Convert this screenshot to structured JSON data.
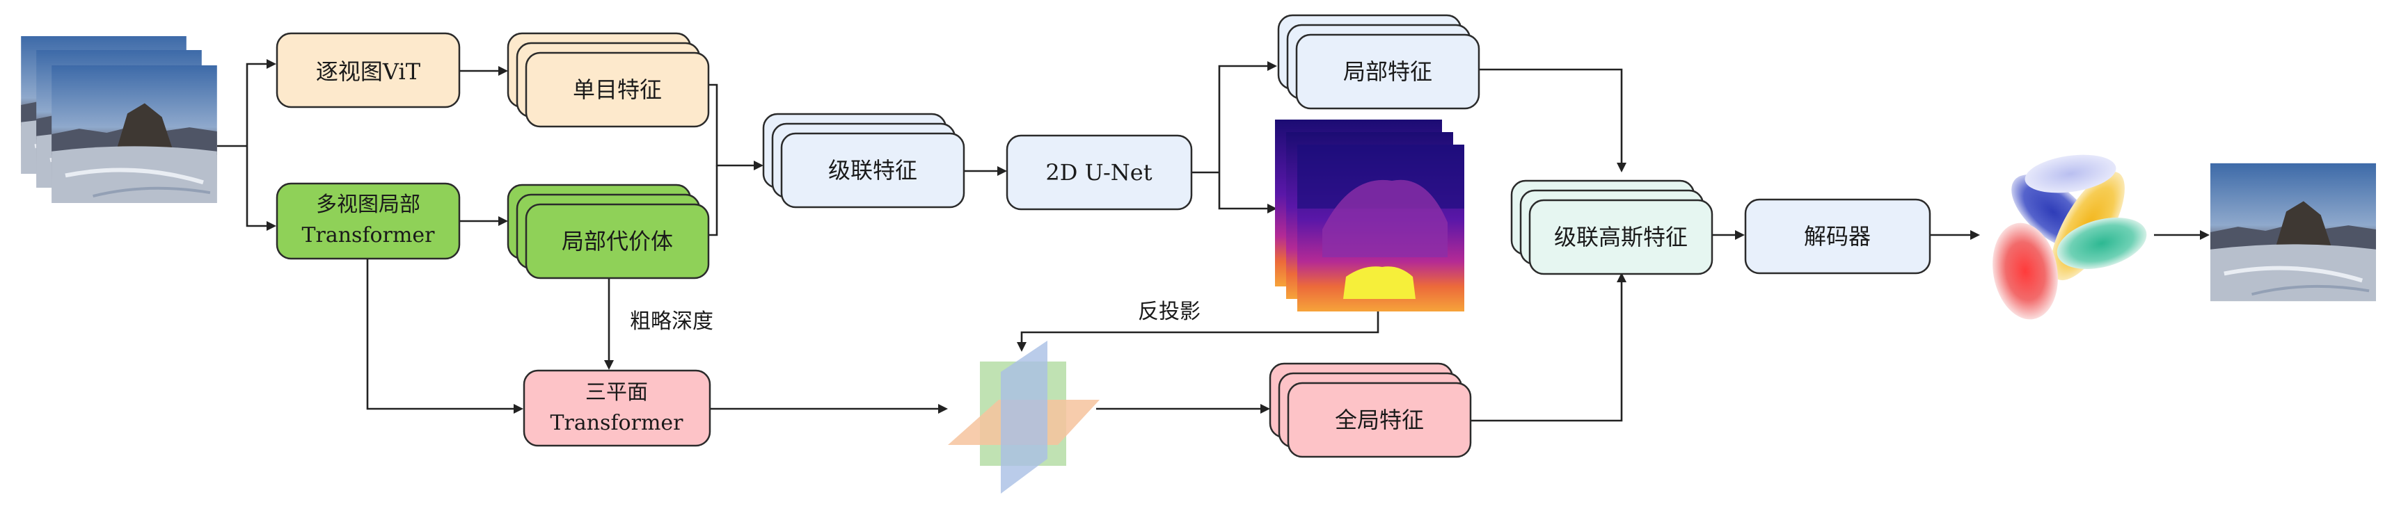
{
  "labels": {
    "per_view_vit": "逐视图ViT",
    "multi_view_local": "多视图局部",
    "transformer": "Transformer",
    "monocular_features": "单目特征",
    "local_cost_volume": "局部代价体",
    "coarse_depth": "粗略深度",
    "triplane": "三平面",
    "concat_features": "级联特征",
    "unet": "2D U-Net",
    "local_features": "局部特征",
    "backproject": "反投影",
    "global_features": "全局特征",
    "concat_gaussian_features": "级联高斯特征",
    "decoder": "解码器"
  },
  "colors": {
    "vit": "#fde9cc",
    "multi_view": "#8fd158",
    "triplane_box": "#fdc3c7",
    "blue_box": "#e8f0fb",
    "mint_box": "#e6f6f1",
    "plane_blue": "#a9bfe5",
    "plane_green": "#b5dda6",
    "plane_orange": "#f6c39e"
  }
}
